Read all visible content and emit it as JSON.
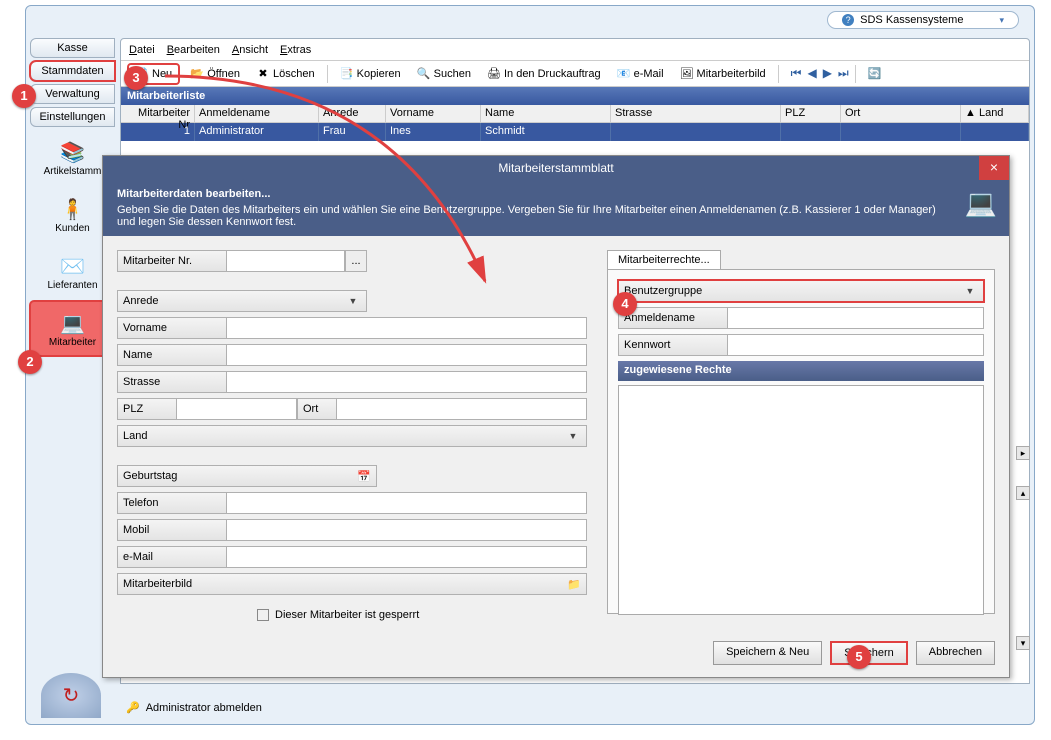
{
  "title": {
    "app": "SDS Kassensysteme"
  },
  "tabs": {
    "kasse": "Kasse",
    "stammdaten": "Stammdaten",
    "verwaltung": "Verwaltung",
    "einstellungen": "Einstellungen"
  },
  "icons": {
    "artikel": "Artikelstamm",
    "kunden": "Kunden",
    "lieferanten": "Lieferanten",
    "mitarbeiter": "Mitarbeiter"
  },
  "menu": {
    "datei": "Datei",
    "bearbeiten": "Bearbeiten",
    "ansicht": "Ansicht",
    "extras": "Extras"
  },
  "tb": {
    "neu": "Neu",
    "oeffnen": "Öffnen",
    "loeschen": "Löschen",
    "kopieren": "Kopieren",
    "suchen": "Suchen",
    "druck": "In den Druckauftrag",
    "email": "e-Mail",
    "bild": "Mitarbeiterbild"
  },
  "list": {
    "title": "Mitarbeiterliste",
    "cols": {
      "nr": "Mitarbeiter Nr",
      "anm": "Anmeldename",
      "anr": "Anrede",
      "vor": "Vorname",
      "nam": "Name",
      "str": "Strasse",
      "plz": "PLZ",
      "ort": "Ort",
      "land": "Land"
    },
    "row": {
      "nr": "1",
      "anm": "Administrator",
      "anr": "Frau",
      "vor": "Ines",
      "nam": "Schmidt",
      "str": "",
      "plz": "",
      "ort": "",
      "land": ""
    }
  },
  "dlg": {
    "title": "Mitarbeiterstammblatt",
    "sub_bold": "Mitarbeiterdaten bearbeiten...",
    "sub_txt": "Geben Sie die Daten des Mitarbeiters ein und wählen Sie eine Benutzergruppe. Vergeben Sie für Ihre Mitarbeiter einen Anmeldenamen (z.B. Kassierer 1 oder Manager) und legen Sie dessen Kennwort fest.",
    "f": {
      "nr": "Mitarbeiter Nr.",
      "anrede": "Anrede",
      "vorname": "Vorname",
      "name": "Name",
      "strasse": "Strasse",
      "plz": "PLZ",
      "ort": "Ort",
      "land": "Land",
      "geb": "Geburtstag",
      "tel": "Telefon",
      "mobil": "Mobil",
      "email": "e-Mail",
      "bild": "Mitarbeiterbild",
      "sperr": "Dieser Mitarbeiter ist gesperrt"
    },
    "rights": {
      "tab": "Mitarbeiterrechte...",
      "grp": "Benutzergruppe",
      "anm": "Anmeldename",
      "kw": "Kennwort",
      "zug": "zugewiesene Rechte"
    },
    "btns": {
      "saveneu": "Speichern & Neu",
      "save": "Speichern",
      "cancel": "Abbrechen"
    }
  },
  "status": "Administrator abmelden",
  "callouts": {
    "c1": "1",
    "c2": "2",
    "c3": "3",
    "c4": "4",
    "c5": "5"
  }
}
